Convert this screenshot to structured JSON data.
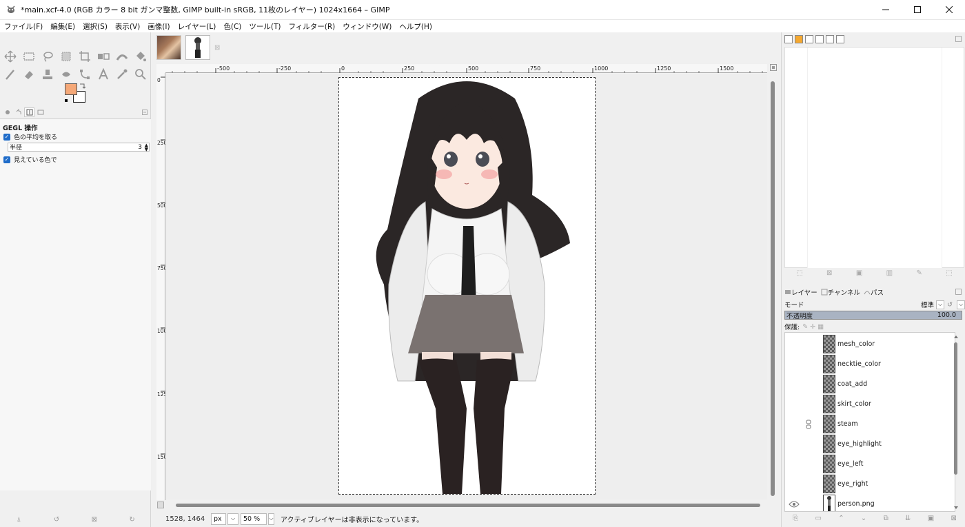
{
  "window": {
    "title": "*main.xcf-4.0 (RGB カラー 8 bit ガンマ整数, GIMP built-in sRGB, 11枚のレイヤー) 1024x1664 – GIMP"
  },
  "menu": [
    "ファイル(F)",
    "編集(E)",
    "選択(S)",
    "表示(V)",
    "画像(I)",
    "レイヤー(L)",
    "色(C)",
    "ツール(T)",
    "フィルター(R)",
    "ウィンドウ(W)",
    "ヘルプ(H)"
  ],
  "tool_options": {
    "title": "GEGL 操作",
    "option1": "色の平均を取る",
    "radius_label": "半径",
    "radius_value": "3",
    "option2": "見えている色で"
  },
  "colors": {
    "foreground": "#f5a878",
    "background": "#ffffff"
  },
  "ruler_h_labels": [
    "-500",
    "-250",
    "0",
    "250",
    "500",
    "750",
    "1000",
    "1250",
    "1500"
  ],
  "ruler_v_labels": [
    "0",
    "250",
    "500",
    "750",
    "1000",
    "1250",
    "1500"
  ],
  "status": {
    "coords": "1528, 1464",
    "unit": "px",
    "zoom": "50 %",
    "message": "アクティブレイヤーは非表示になっています。"
  },
  "layers_panel": {
    "tab_layers": "レイヤー",
    "tab_channels": "チャンネル",
    "tab_paths": "パス",
    "mode_label": "モード",
    "mode_value": "標準",
    "opacity_label": "不透明度",
    "opacity_value": "100.0",
    "lock_label": "保護:"
  },
  "layers": [
    {
      "name": "mesh_color",
      "visible": false,
      "linked": false
    },
    {
      "name": "necktie_color",
      "visible": false,
      "linked": false
    },
    {
      "name": "coat_add",
      "visible": false,
      "linked": false
    },
    {
      "name": "skirt_color",
      "visible": false,
      "linked": false
    },
    {
      "name": "steam",
      "visible": false,
      "linked": true
    },
    {
      "name": "eye_highlight",
      "visible": false,
      "linked": false
    },
    {
      "name": "eye_left",
      "visible": false,
      "linked": false
    },
    {
      "name": "eye_right",
      "visible": false,
      "linked": false
    },
    {
      "name": "person.png",
      "visible": true,
      "linked": false
    }
  ]
}
